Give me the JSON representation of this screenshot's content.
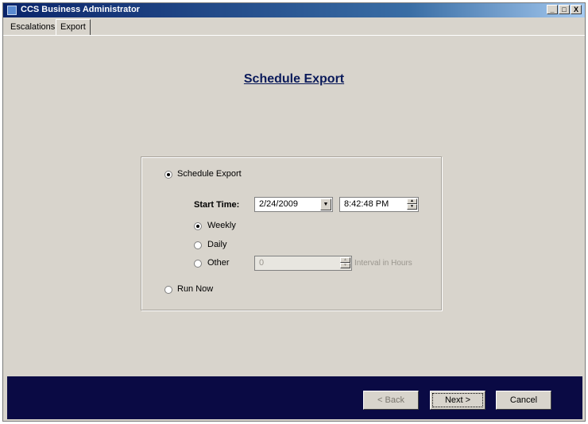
{
  "window": {
    "title": "CCS Business Administrator",
    "controls": {
      "minimize": "_",
      "maximize": "□",
      "close": "X"
    }
  },
  "tabs": [
    {
      "label": "Escalations",
      "active": false
    },
    {
      "label": "Export",
      "active": true
    }
  ],
  "page": {
    "title": "Schedule Export"
  },
  "options": {
    "schedule_export": {
      "label": "Schedule Export",
      "checked": true
    },
    "start_time": {
      "label": "Start Time:",
      "date": "2/24/2009",
      "time": "8:42:48 PM"
    },
    "weekly": {
      "label": "Weekly",
      "checked": true
    },
    "daily": {
      "label": "Daily",
      "checked": false
    },
    "other": {
      "label": "Other",
      "checked": false,
      "value": "0",
      "unit_label": "Interval in Hours"
    },
    "run_now": {
      "label": "Run Now",
      "checked": false
    }
  },
  "footer": {
    "back_label": "< Back",
    "next_label": "Next >",
    "cancel_label": "Cancel"
  },
  "colors": {
    "footer_bg": "#0a0a44",
    "title_color": "#0a1a5a",
    "window_bg": "#d8d4cc"
  }
}
